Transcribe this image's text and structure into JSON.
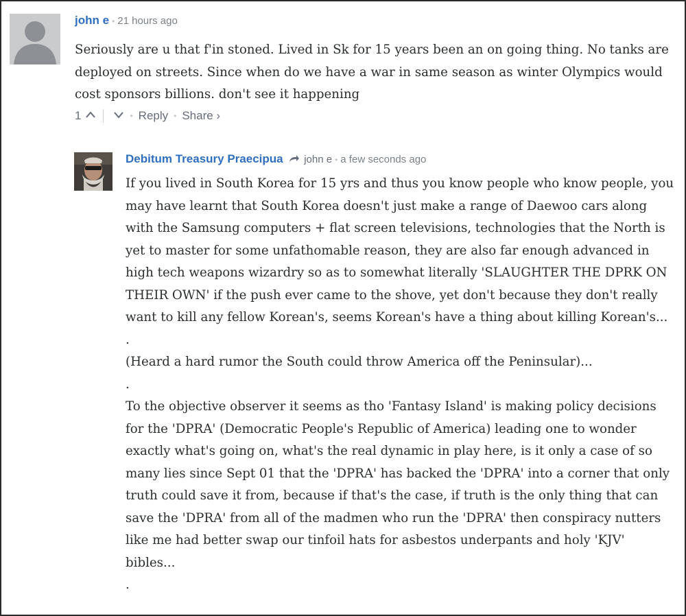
{
  "comments": [
    {
      "author": "john e",
      "time": "21 hours ago",
      "avatar_icon": "default-user-icon",
      "paragraphs": [
        "Seriously are u that f'in stoned. Lived in Sk for 15 years been an on going thing. No tanks are deployed on streets. Since when do we have a war in same season as winter Olympics would cost sponsors billions. don't see it happening"
      ],
      "votes": "1",
      "actions": {
        "reply": "Reply",
        "share": "Share ›"
      }
    },
    {
      "author": "Debitum Treasury Praecipua",
      "reply_to": "john e",
      "time": "a few seconds ago",
      "avatar_icon": "user-photo-avatar",
      "paragraphs": [
        "If you lived in South Korea for 15 yrs and thus you know people who know people, you may have learnt that South Korea doesn't just make a range of Daewoo cars along with the Samsung computers + flat screen televisions, technologies that the North is yet to master for some unfathomable reason, they are also far enough advanced in high tech weapons wizardry so as to somewhat literally 'SLAUGHTER THE DPRK ON THEIR OWN' if the push ever came to the shove, yet don't because they don't really want to kill any fellow Korean's, seems Korean's have a thing about killing Korean's...",
        ".",
        "(Heard a hard rumor the South could throw America off the Peninsular)...",
        ".",
        "To the objective observer it seems as tho 'Fantasy Island' is making policy decisions for the 'DPRA' (Democratic People's Republic of America) leading one to wonder exactly what's going on, what's the real dynamic in play here, is it only a case of so many lies since Sept 01 that the 'DPRA' has backed the 'DPRA' into a corner that only truth could save it from, because if that's the case, if truth is the only thing that can save the 'DPRA' from all of the madmen who run the 'DPRA' then conspiracy nutters like me had better swap our tinfoil hats for asbestos underpants and holy 'KJV' bibles...",
        "."
      ]
    }
  ],
  "colors": {
    "author": "#2e6fc1",
    "text": "#2a2e2e",
    "meta": "#7a8288"
  }
}
